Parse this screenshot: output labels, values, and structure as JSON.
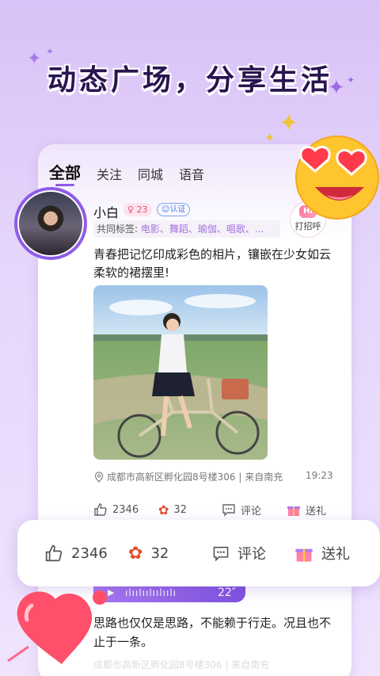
{
  "banner": {
    "title": "动态广场，分享生活"
  },
  "tabs": [
    {
      "label": "全部",
      "active": true
    },
    {
      "label": "关注",
      "active": false
    },
    {
      "label": "同城",
      "active": false
    },
    {
      "label": "语音",
      "active": false
    }
  ],
  "post": {
    "user": {
      "name": "小白",
      "age": "23",
      "verified_label": "认证"
    },
    "tags": {
      "label": "共同标签:",
      "values": "电影、舞蹈、瑜伽、唱歌、..."
    },
    "greet_label": "打招呼",
    "greet_badge": "Hi",
    "text": "青春把记忆印成彩色的相片，镶嵌在少女如云柔软的裙摆里!",
    "location": "成都市高新区孵化园8号楼306 | 来自南充",
    "time": "19:23",
    "likes": "2346",
    "flowers": "32",
    "comment_label": "评论",
    "gift_label": "送礼"
  },
  "overlay": {
    "likes": "2346",
    "flowers": "32",
    "comment_label": "评论",
    "gift_label": "送礼"
  },
  "post2": {
    "voice_duration": "22″",
    "text": "思路也仅仅是思路，不能赖于行走。况且也不止于一条。",
    "location": "成都市高新区孵化园8号楼306 | 来自南充"
  },
  "colors": {
    "accent": "#8c5be6",
    "pink": "#e14e86",
    "tag_value": "#a770e0"
  }
}
